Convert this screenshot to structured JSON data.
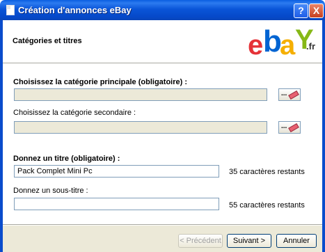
{
  "window": {
    "title": "Création d'annonces eBay",
    "help_label": "?",
    "close_label": "X"
  },
  "header": {
    "title": "Catégories et titres",
    "logo": {
      "e": "e",
      "b": "b",
      "a": "a",
      "y": "Y",
      "suffix": ".fr"
    }
  },
  "form": {
    "primary_category": {
      "label": "Choisissez la catégorie principale (obligatoire) :",
      "value": "",
      "button_label": "..."
    },
    "secondary_category": {
      "label": "Choisissez la catégorie secondaire :",
      "value": "",
      "button_label": "..."
    },
    "title": {
      "label": "Donnez un titre (obligatoire) :",
      "value": "Pack Complet Mini Pc",
      "remaining": "35 caractères restants"
    },
    "subtitle": {
      "label": "Donnez un sous-titre :",
      "value": "",
      "remaining": "55 caractères restants"
    }
  },
  "footer": {
    "previous_label": "< Précédent",
    "next_label": "Suivant >",
    "cancel_label": "Annuler"
  },
  "colors": {
    "titlebar": "#0a55d8",
    "panel": "#ece9d8",
    "field_border": "#7f9db9"
  }
}
